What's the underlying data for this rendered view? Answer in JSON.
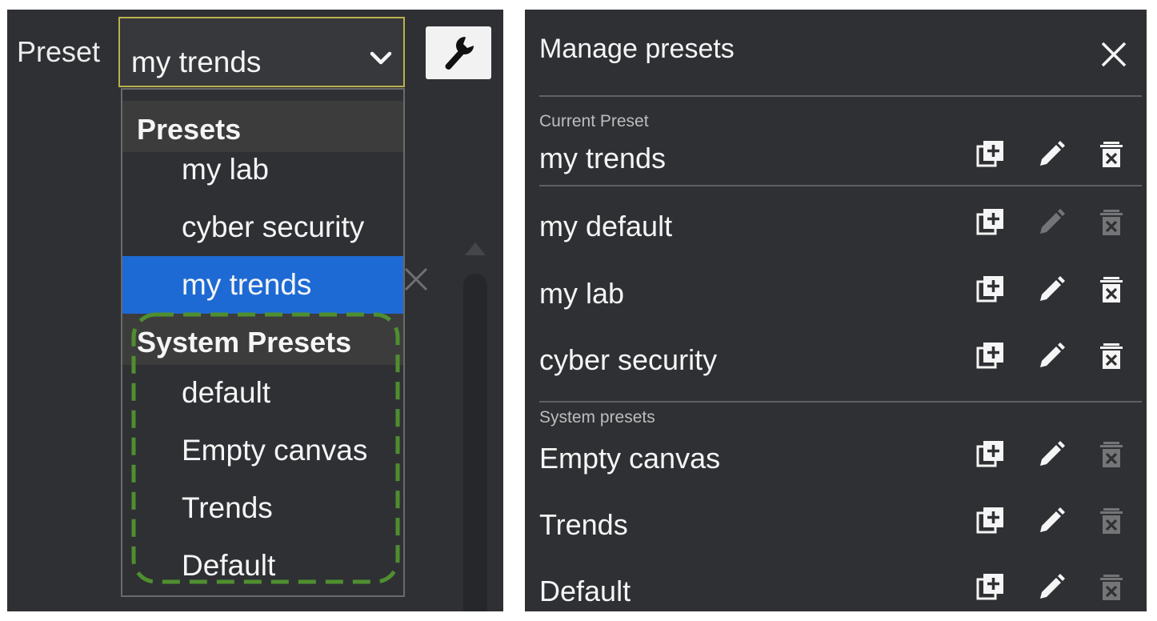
{
  "left": {
    "preset_label": "Preset",
    "selected_value": "my trends",
    "dropdown": {
      "groups": [
        {
          "header": "Presets",
          "items": [
            {
              "label": "my lab",
              "selected": false
            },
            {
              "label": "cyber security",
              "selected": false
            },
            {
              "label": "my trends",
              "selected": true
            }
          ]
        },
        {
          "header": "System Presets",
          "items": [
            {
              "label": "default",
              "selected": false
            },
            {
              "label": "Empty canvas",
              "selected": false
            },
            {
              "label": "Trends",
              "selected": false
            },
            {
              "label": "Default",
              "selected": false
            }
          ]
        }
      ]
    },
    "colors": {
      "select_border": "#b9b14a",
      "selected_bg": "#1e6ad4",
      "outline": "#4f8f2f"
    },
    "icons": [
      "chevron-down-icon",
      "wrench-icon",
      "close-icon"
    ]
  },
  "manage": {
    "title": "Manage presets",
    "current_label": "Current Preset",
    "current": {
      "name": "my trends",
      "copy": true,
      "edit": true,
      "delete": true
    },
    "user_presets": [
      {
        "name": "my default",
        "copy": true,
        "edit": false,
        "delete": false
      },
      {
        "name": "my lab",
        "copy": true,
        "edit": true,
        "delete": true
      },
      {
        "name": "cyber security",
        "copy": true,
        "edit": true,
        "delete": true
      }
    ],
    "system_label": "System presets",
    "system_presets": [
      {
        "name": "Empty canvas",
        "copy": true,
        "edit": true,
        "delete": false
      },
      {
        "name": "Trends",
        "copy": true,
        "edit": true,
        "delete": false
      },
      {
        "name": "Default",
        "copy": true,
        "edit": true,
        "delete": false
      }
    ],
    "icons": [
      "close-icon",
      "duplicate-icon",
      "pencil-icon",
      "delete-icon"
    ]
  }
}
